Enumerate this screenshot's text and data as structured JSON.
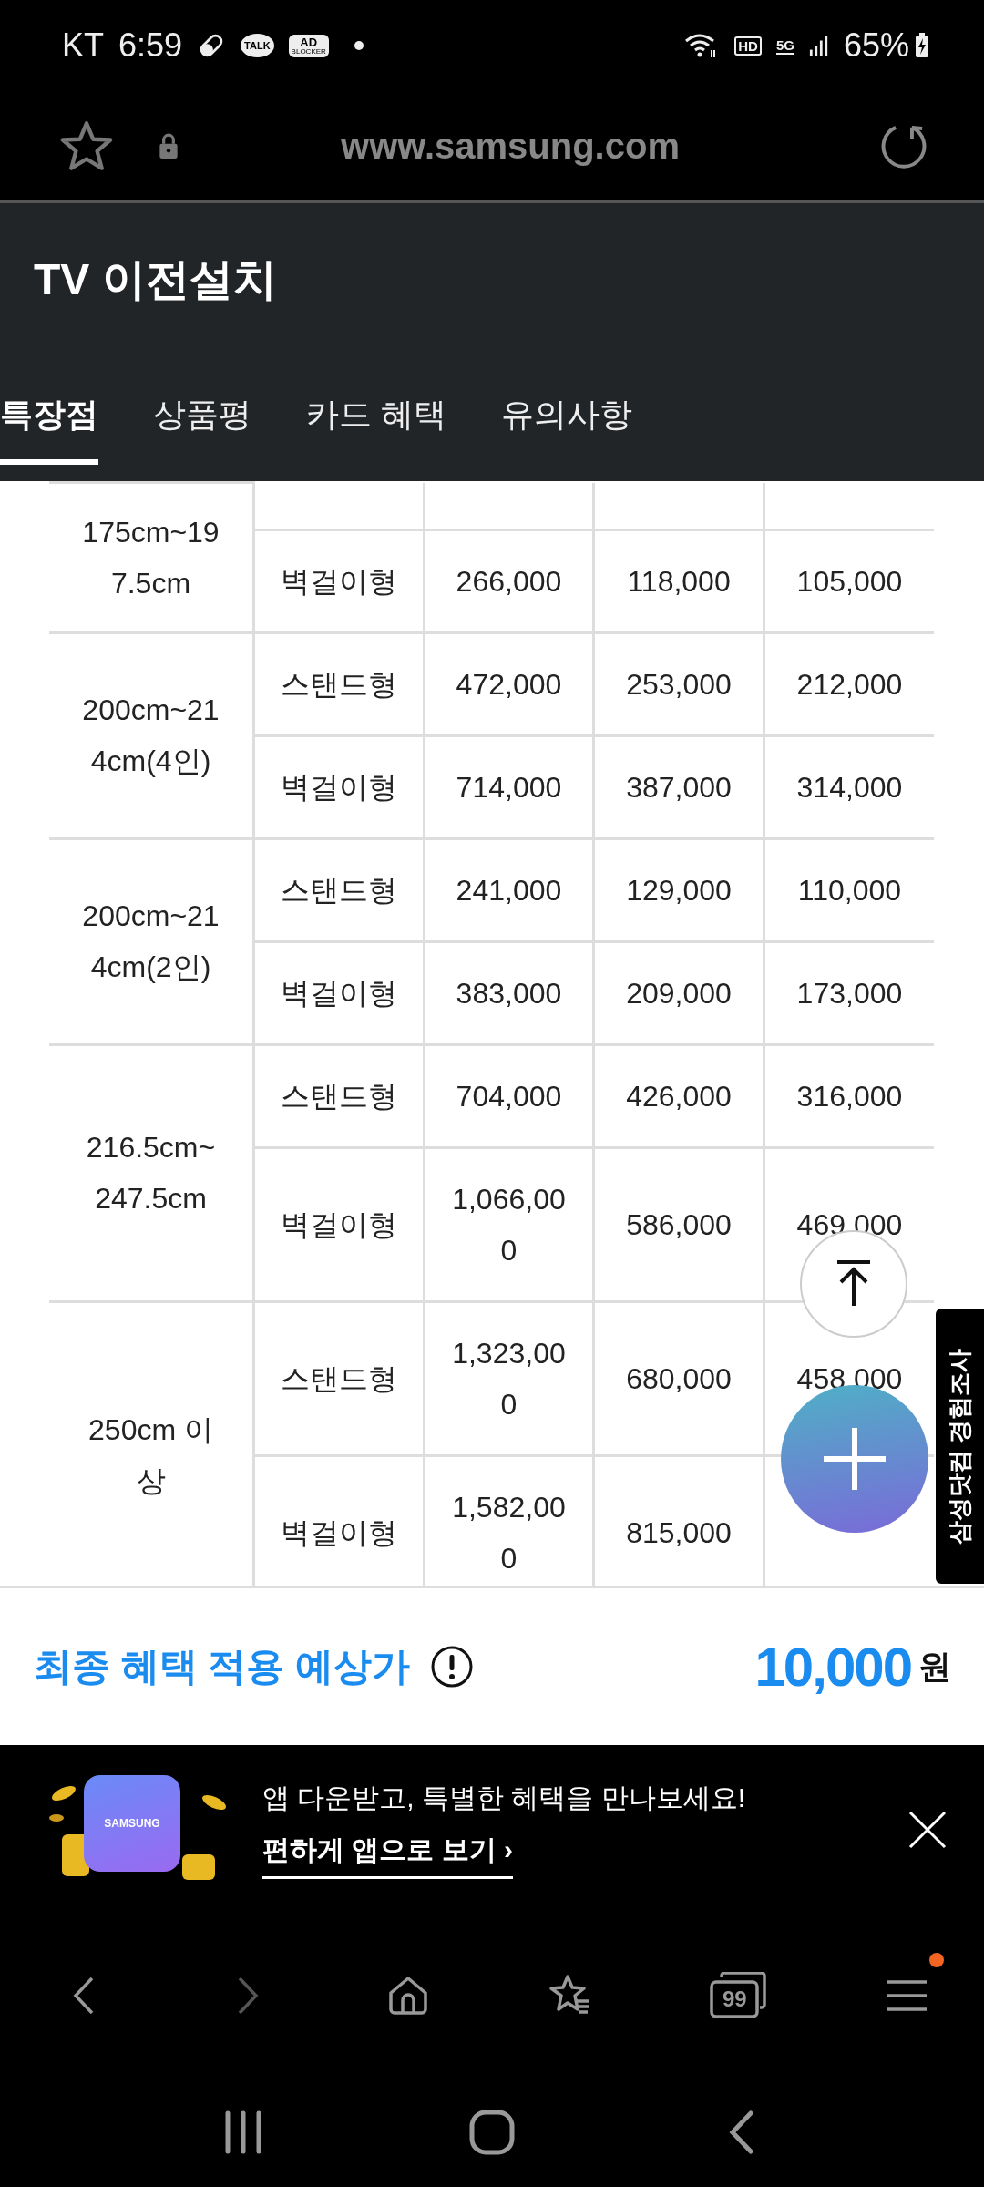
{
  "status_bar": {
    "carrier": "KT",
    "time": "6:59",
    "talk_badge": "TALK",
    "adblock_badge": {
      "top": "AD",
      "bottom": "BLOCKER"
    },
    "hd_badge": "HD",
    "network": "5G",
    "battery": "65%"
  },
  "address_bar": {
    "url": "www.samsung.com"
  },
  "page_header": {
    "title": "TV 이전설치"
  },
  "tabs": [
    {
      "label": "특장점",
      "selected": true
    },
    {
      "label": "상품평",
      "selected": false
    },
    {
      "label": "카드 혜택",
      "selected": false
    },
    {
      "label": "유의사항",
      "selected": false
    }
  ],
  "price_table": {
    "groups": [
      {
        "size": "175cm~197.5cm",
        "cut_off_row": true,
        "rows": [
          {
            "type": "벽걸이형",
            "values": [
              "266,000",
              "118,000",
              "105,000"
            ]
          }
        ]
      },
      {
        "size": "200cm~214cm(4인)",
        "cut_off_row": false,
        "rows": [
          {
            "type": "스탠드형",
            "values": [
              "472,000",
              "253,000",
              "212,000"
            ]
          },
          {
            "type": "벽걸이형",
            "values": [
              "714,000",
              "387,000",
              "314,000"
            ]
          }
        ]
      },
      {
        "size": "200cm~214cm(2인)",
        "cut_off_row": false,
        "rows": [
          {
            "type": "스탠드형",
            "values": [
              "241,000",
              "129,000",
              "110,000"
            ]
          },
          {
            "type": "벽걸이형",
            "values": [
              "383,000",
              "209,000",
              "173,000"
            ]
          }
        ]
      },
      {
        "size": "216.5cm~247.5cm",
        "cut_off_row": false,
        "rows": [
          {
            "type": "스탠드형",
            "values": [
              "704,000",
              "426,000",
              "316,000"
            ]
          },
          {
            "type": "벽걸이형",
            "values": [
              "1,066,000",
              "586,000",
              "469,000"
            ]
          }
        ]
      },
      {
        "size": "250cm 이상",
        "cut_off_row": false,
        "rows": [
          {
            "type": "스탠드형",
            "values": [
              "1,323,000",
              "680,000",
              "458,000"
            ]
          },
          {
            "type": "벽걸이형",
            "values": [
              "1,582,000",
              "815,000"
            ]
          }
        ]
      }
    ]
  },
  "side_tab": {
    "label": "삼성닷컴 경험조사"
  },
  "price_summary": {
    "label": "최종 혜택 적용 예상가",
    "amount": "10,000",
    "unit": "원"
  },
  "app_banner": {
    "icon_text": "SAMSUNG",
    "message": "앱 다운받고, 특별한 혜택을 만나보세요!",
    "link": "편하게 앱으로 보기 ›"
  },
  "browser_toolbar": {
    "forward_enabled": false,
    "tabs_count": "99",
    "menu_badge": true
  }
}
